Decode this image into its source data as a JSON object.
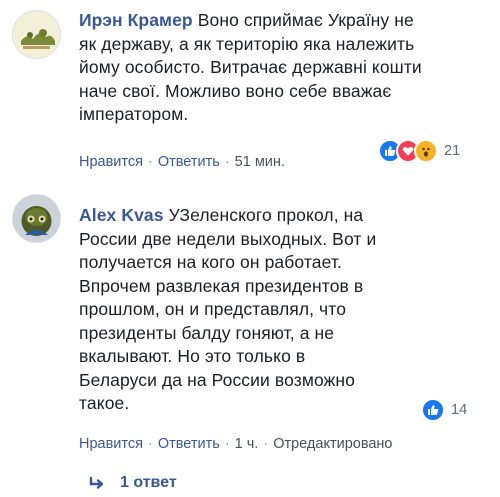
{
  "comments": [
    {
      "author": "Ирэн Крамер",
      "lines": [
        "Воно сприймає Україну не",
        "як державу, а як територію яка належить",
        "йому особисто. Витрачає державні кошти",
        "наче свої. Можливо воно себе вважає",
        "імператором."
      ],
      "like_label": "Нравится",
      "reply_label": "Ответить",
      "time": "51 мин.",
      "reactions": [
        "like-icon",
        "love-icon",
        "wow-icon"
      ],
      "reaction_count": "21"
    },
    {
      "author": "Alex Kvas",
      "lines": [
        "УЗеленского прокол, на",
        "России две недели выходных. Вот и",
        "получается на кого он работает.",
        "Впрочем развлекая президентов в",
        "прошлом, он и представлял, что",
        "президенты балду гоняют, а не",
        "вкалывают. Но это только в",
        "Беларуси да на России возможно",
        "такое."
      ],
      "like_label": "Нравится",
      "reply_label": "Ответить",
      "time": "1 ч.",
      "edited_label": "Отредактировано",
      "reactions": [
        "like-icon"
      ],
      "reaction_count": "14",
      "replies_label": "1 ответ"
    }
  ],
  "colors": {
    "link": "#385898",
    "meta": "#4b4f56",
    "like_blue": "#1877f2",
    "love_red": "#f33e58",
    "wow_yellow": "#f7b125"
  }
}
